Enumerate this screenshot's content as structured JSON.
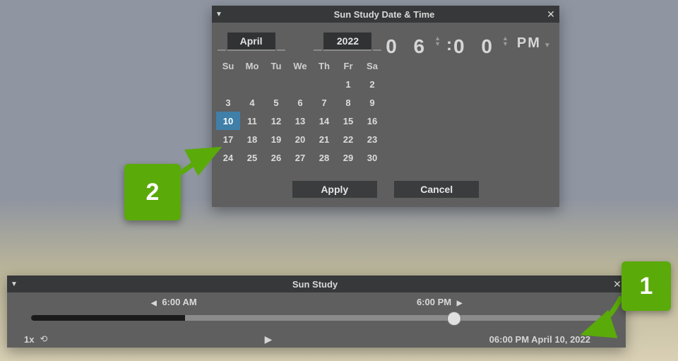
{
  "dialog": {
    "title": "Sun Study Date & Time",
    "month": "April",
    "year": "2022",
    "dow": [
      "Su",
      "Mo",
      "Tu",
      "We",
      "Th",
      "Fr",
      "Sa"
    ],
    "weeks": [
      [
        "",
        "",
        "",
        "",
        "",
        "1",
        "2"
      ],
      [
        "3",
        "4",
        "5",
        "6",
        "7",
        "8",
        "9"
      ],
      [
        "10",
        "11",
        "12",
        "13",
        "14",
        "15",
        "16"
      ],
      [
        "17",
        "18",
        "19",
        "20",
        "21",
        "22",
        "23"
      ],
      [
        "24",
        "25",
        "26",
        "27",
        "28",
        "29",
        "30"
      ]
    ],
    "selected_day": "10",
    "time": {
      "hour": "0 6",
      "minute": "0 0",
      "ampm": "PM"
    },
    "buttons": {
      "apply": "Apply",
      "cancel": "Cancel"
    }
  },
  "timeline": {
    "title": "Sun Study",
    "start_label": "6:00  AM",
    "end_label": "6:00  PM",
    "speed": "1x",
    "timestamp": "06:00 PM April 10, 2022",
    "handle_pct": 74,
    "dark_pct": 27
  },
  "callouts": {
    "c1": "1",
    "c2": "2"
  }
}
